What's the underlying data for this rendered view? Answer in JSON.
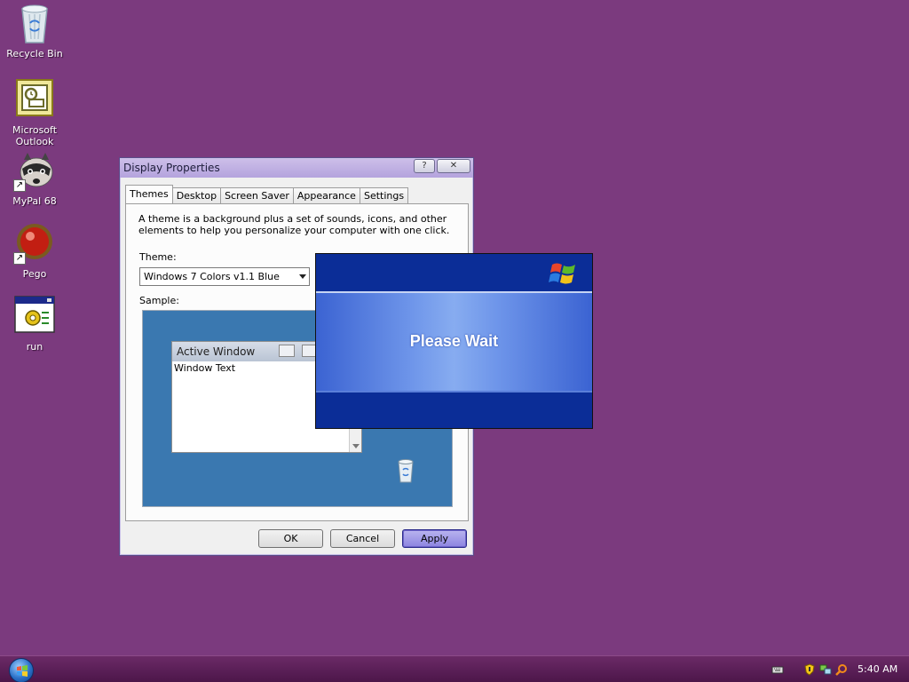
{
  "desktop": {
    "background_color": "#7b3a7e",
    "icons": [
      {
        "label": "Recycle Bin",
        "icon": "recycle-bin-icon"
      },
      {
        "label": "Microsoft Outlook",
        "icon": "outlook-icon"
      },
      {
        "label": "MyPal 68",
        "icon": "mypal-raccoon-icon"
      },
      {
        "label": "Pego",
        "icon": "pego-red-ball-icon"
      },
      {
        "label": "run",
        "icon": "run-gear-window-icon"
      }
    ]
  },
  "dialog": {
    "title": "Display Properties",
    "help_glyph": "?",
    "close_glyph": "✕",
    "tabs": [
      "Themes",
      "Desktop",
      "Screen Saver",
      "Appearance",
      "Settings"
    ],
    "active_tab": "Themes",
    "description": "A theme is a background plus a set of sounds, icons, and other elements to help you personalize your computer with one click.",
    "theme_label": "Theme:",
    "theme_value": "Windows 7 Colors v1.1 Blue",
    "sample_label": "Sample:",
    "sample_window": {
      "title": "Active Window",
      "body_text": "Window Text"
    },
    "buttons": {
      "ok": "OK",
      "cancel": "Cancel",
      "apply": "Apply"
    }
  },
  "splash": {
    "message": "Please Wait",
    "logo": "windows-xp-flag-icon",
    "accent": "#0b2d97"
  },
  "taskbar": {
    "clock": "5:40 AM",
    "tray_icons": [
      "keyboard-icon",
      "security-shield-icon",
      "network-icon",
      "search-icon"
    ]
  }
}
